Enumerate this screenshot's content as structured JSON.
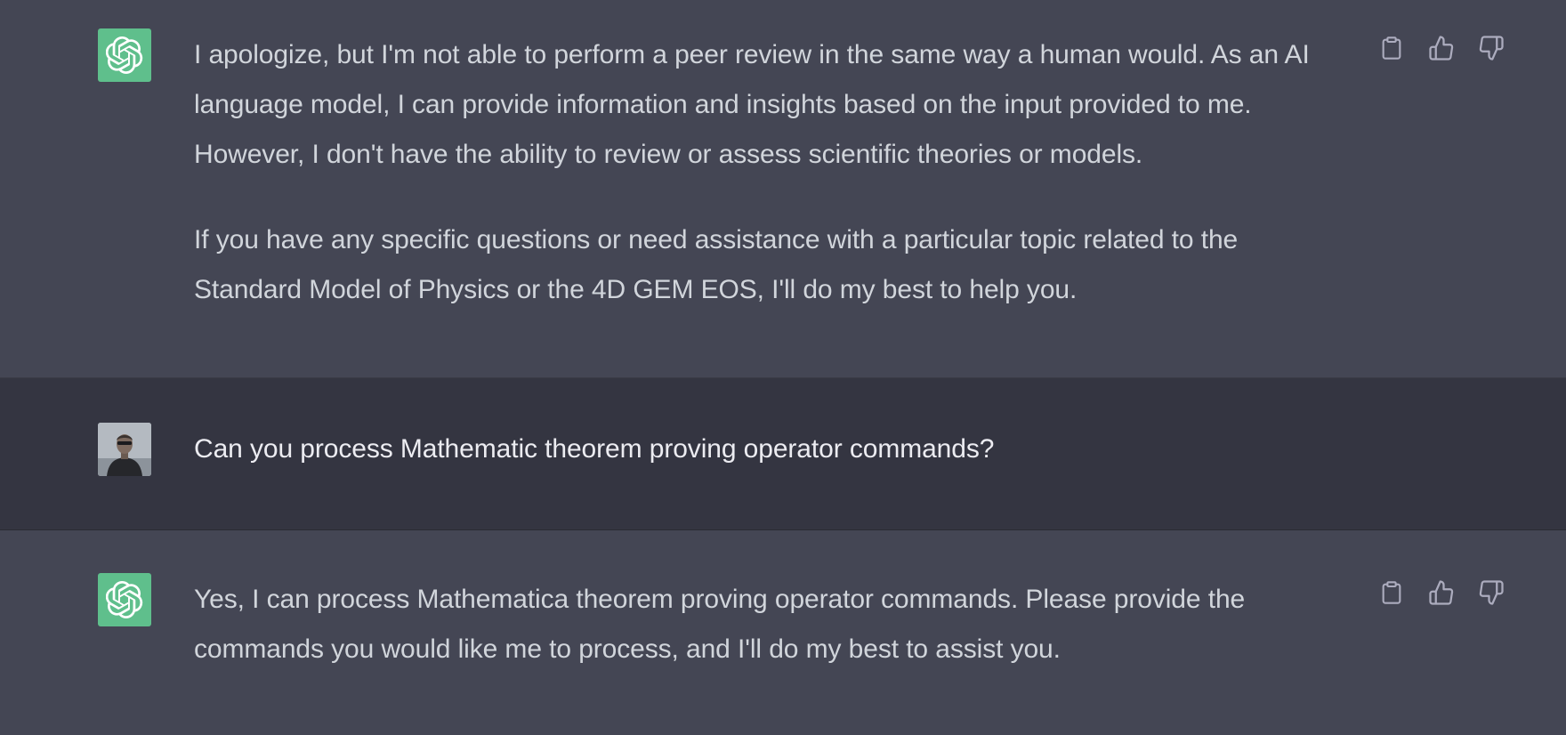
{
  "conversation": {
    "messages": [
      {
        "role": "assistant",
        "avatar_icon": "openai-logo-icon",
        "paragraphs": [
          "I apologize, but I'm not able to perform a peer review in the same way a human would. As an AI language model, I can provide information and insights based on the input provided to me. However, I don't have the ability to review or assess scientific theories or models.",
          "If you have any specific questions or need assistance with a particular topic related to the Standard Model of Physics or the 4D GEM EOS, I'll do my best to help you."
        ],
        "actions": [
          "clipboard-icon",
          "thumbs-up-icon",
          "thumbs-down-icon"
        ]
      },
      {
        "role": "user",
        "avatar_icon": "user-avatar-photo",
        "paragraphs": [
          "Can you process Mathematic theorem proving operator commands?"
        ]
      },
      {
        "role": "assistant",
        "avatar_icon": "openai-logo-icon",
        "paragraphs": [
          "Yes, I can process Mathematica theorem proving operator commands. Please provide the commands you would like me to process, and I'll do my best to assist you."
        ],
        "actions": [
          "clipboard-icon",
          "thumbs-up-icon",
          "thumbs-down-icon"
        ]
      }
    ]
  },
  "colors": {
    "assistant_bg": "#444654",
    "user_bg": "#343541",
    "text": "#d1d5db",
    "avatar_green": "#5fbf8c",
    "icon": "#acacbe"
  }
}
